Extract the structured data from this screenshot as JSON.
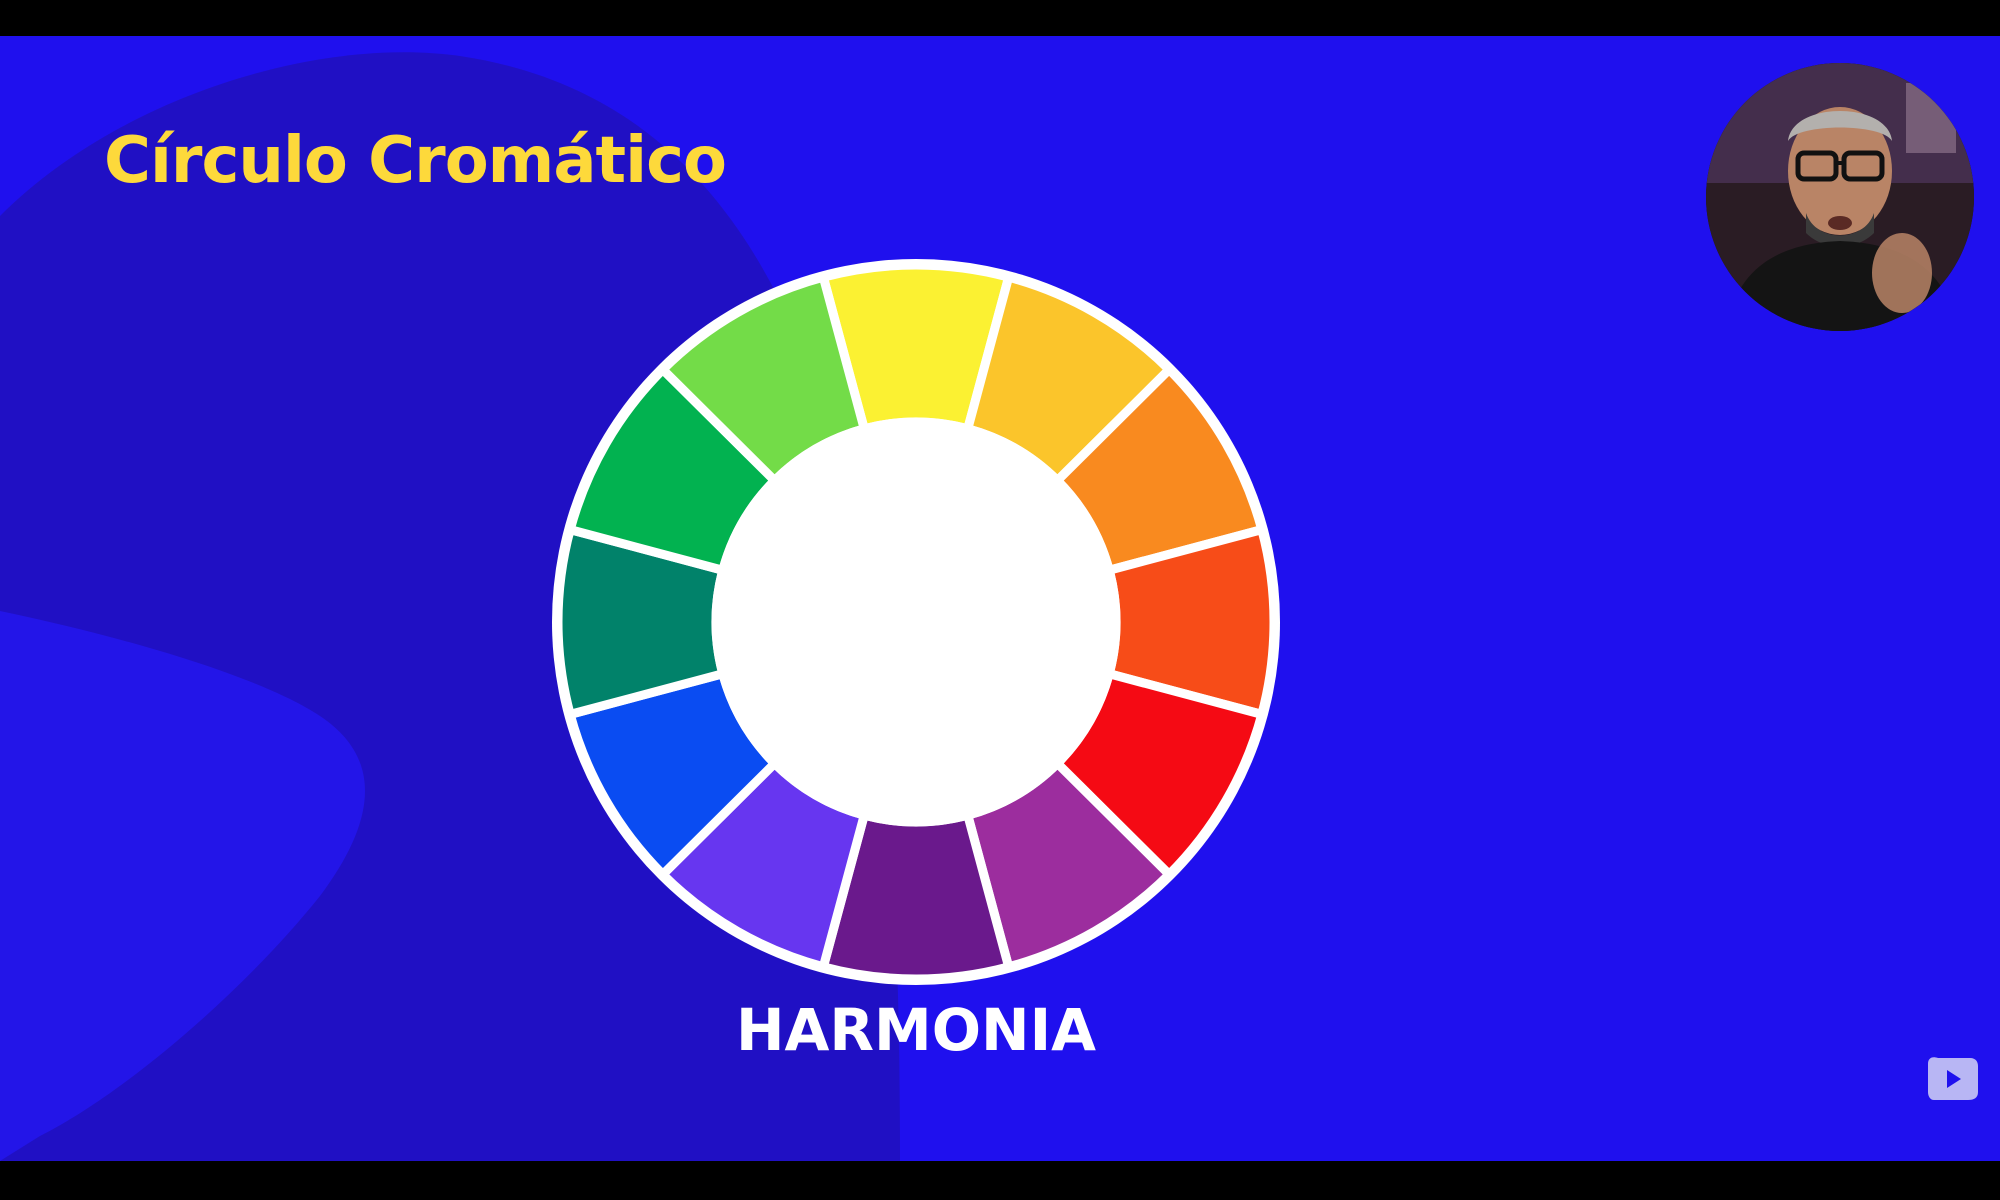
{
  "slide": {
    "title": "Círculo Cromático",
    "caption": "HARMONIA",
    "background_color": "#1f10ee",
    "title_color": "#fdd93b"
  },
  "color_wheel": {
    "segments": [
      {
        "name": "yellow",
        "color": "#fbf132"
      },
      {
        "name": "yellow-orange",
        "color": "#fbc52b"
      },
      {
        "name": "orange",
        "color": "#f98a1f"
      },
      {
        "name": "red-orange",
        "color": "#f74c18"
      },
      {
        "name": "red",
        "color": "#f50a14"
      },
      {
        "name": "red-violet",
        "color": "#9c2d9e"
      },
      {
        "name": "violet",
        "color": "#6a198c"
      },
      {
        "name": "blue-violet",
        "color": "#6736f0"
      },
      {
        "name": "blue",
        "color": "#0a4cf2"
      },
      {
        "name": "blue-green",
        "color": "#01826a"
      },
      {
        "name": "green",
        "color": "#02b250"
      },
      {
        "name": "yellow-green",
        "color": "#73dc48"
      }
    ],
    "divider_color": "#ffffff"
  },
  "overlay": {
    "presenter": "presenter-webcam",
    "watermark_icon": "play-button-icon"
  }
}
